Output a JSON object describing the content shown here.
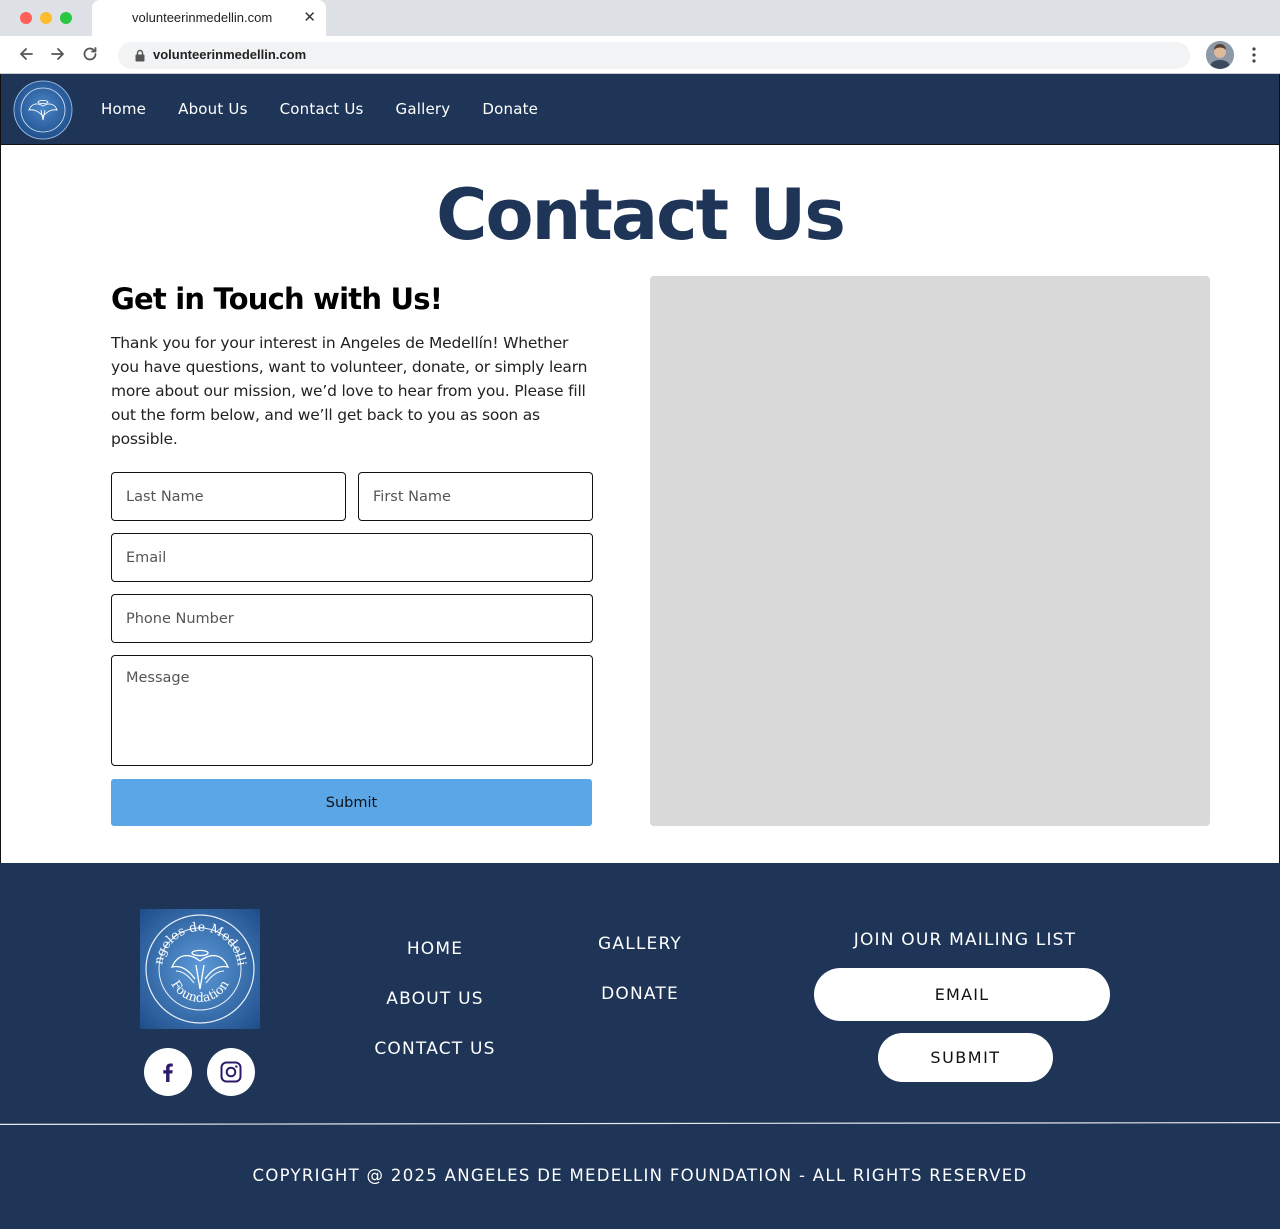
{
  "browser": {
    "tab_title": "volunteerinmedellin.com",
    "url": "volunteerinmedellin.com"
  },
  "nav": {
    "logo_icon": "angel-foundation-logo-icon",
    "items": [
      {
        "label": "Home"
      },
      {
        "label": "About Us"
      },
      {
        "label": "Contact Us"
      },
      {
        "label": "Gallery"
      },
      {
        "label": "Donate"
      }
    ]
  },
  "main": {
    "title": "Contact Us",
    "heading": "Get in Touch with Us!",
    "intro": "Thank you for your interest in Angeles de Medellín! Whether you have questions, want to volunteer, donate, or simply learn more about our mission, we’d love to hear from you. Please fill out the form below, and we’ll get back to you as soon as possible.",
    "form": {
      "last_name_placeholder": "Last Name",
      "first_name_placeholder": "First Name",
      "email_placeholder": "Email",
      "phone_placeholder": "Phone Number",
      "message_placeholder": "Message",
      "submit_label": "Submit"
    }
  },
  "footer": {
    "logo_text_top": "Angeles de Medellin",
    "logo_text_bottom": "Foundation",
    "social": [
      {
        "icon": "facebook-icon"
      },
      {
        "icon": "instagram-icon"
      }
    ],
    "links_col1": [
      {
        "label": "HOME"
      },
      {
        "label": "ABOUT US"
      },
      {
        "label": "CONTACT US"
      }
    ],
    "links_col2": [
      {
        "label": "GALLERY"
      },
      {
        "label": "DONATE"
      }
    ],
    "mailing": {
      "heading": "JOIN OUR MAILING LIST",
      "email_placeholder": "EMAIL",
      "submit_label": "SUBMIT"
    },
    "copyright": "COPYRIGHT @ 2025  ANGELES DE MEDELLIN FOUNDATION - ALL RIGHTS RESERVED"
  },
  "colors": {
    "navy": "#1e3557",
    "submit_blue": "#5aa6e6",
    "placeholder_gray": "#d9d9d9"
  }
}
